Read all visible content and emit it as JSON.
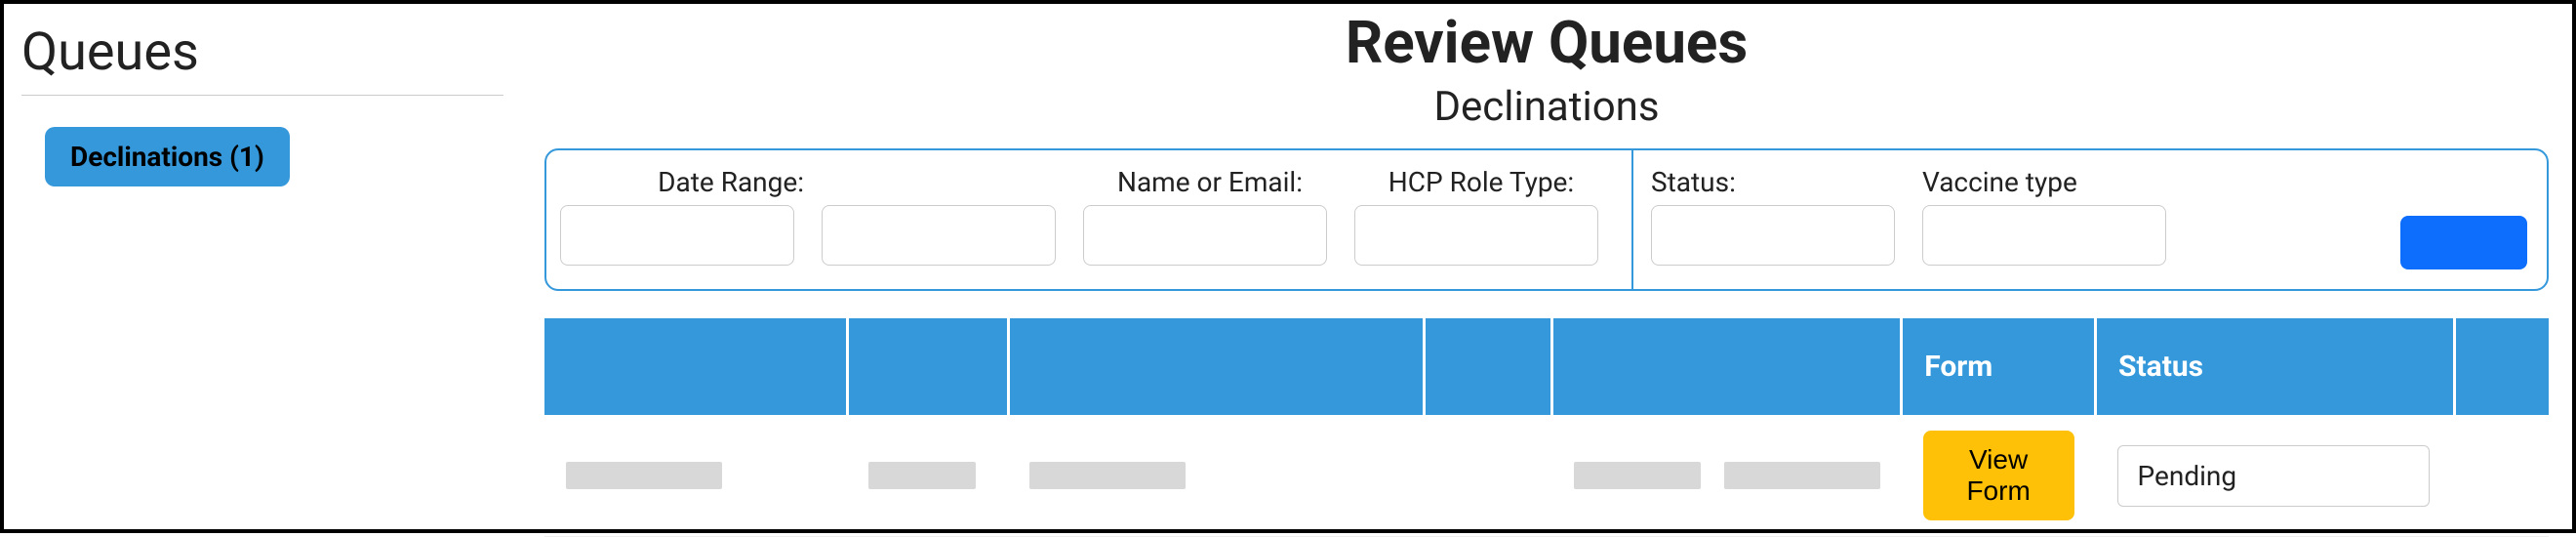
{
  "sidebar": {
    "title": "Queues",
    "items": [
      {
        "label": "Declinations (1)"
      }
    ]
  },
  "header": {
    "title": "Review Queues",
    "subtitle": "Declinations"
  },
  "filters": {
    "date_range": {
      "label": "Date Range:",
      "value1": "",
      "value2": ""
    },
    "name_email": {
      "label": "Name or Email:",
      "value": ""
    },
    "hcp_role": {
      "label": "HCP Role Type:",
      "value": ""
    },
    "status": {
      "label": "Status:",
      "value": ""
    },
    "vaccine": {
      "label": "Vaccine type",
      "value": ""
    },
    "search_label": ""
  },
  "table": {
    "headers": [
      "",
      "",
      "",
      "",
      "",
      "Form",
      "Status",
      ""
    ],
    "rows": [
      {
        "c1": "",
        "c2": "",
        "c3": "",
        "c4": "",
        "c5": "",
        "form_button": "View Form",
        "status": "Pending"
      }
    ]
  }
}
